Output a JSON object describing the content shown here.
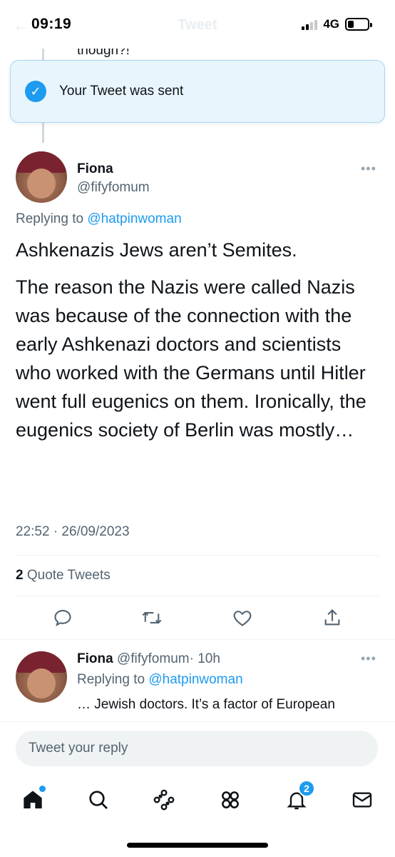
{
  "status_bar": {
    "time": "09:19",
    "title": "Tweet",
    "network": "4G"
  },
  "previous_tweet": {
    "text_fragment": "though?!"
  },
  "toast": {
    "message": "Your Tweet was sent"
  },
  "main_tweet": {
    "author_name": "Fiona",
    "author_handle": "@fifyfomum",
    "replying_prefix": "Replying to ",
    "replying_to": "@hatpinwoman",
    "paragraphs": [
      "Ashkenazis Jews aren’t Semites.",
      "The reason the Nazis were called Nazis was because of the connection with the early Ashkenazi doctors and scientists who worked with the Germans until Hitler went full eugenics on them. Ironically, the eugenics society of Berlin was mostly…"
    ],
    "timestamp": "22:52 · 26/09/2023",
    "quote_count": "2",
    "quote_label": " Quote Tweets"
  },
  "reply_tweet": {
    "author_name": "Fiona",
    "author_handle": "@fifyfomum",
    "time_ago": "· 10h",
    "replying_prefix": "Replying to ",
    "replying_to": "@hatpinwoman",
    "text": "… Jewish doctors. It’s a factor of European"
  },
  "reply_composer": {
    "placeholder": "Tweet your reply"
  },
  "tabbar": {
    "notifications_badge": "2"
  },
  "colors": {
    "accent": "#1d9bf0",
    "secondary_text": "#536471",
    "toast_bg": "#e8f5fd"
  }
}
